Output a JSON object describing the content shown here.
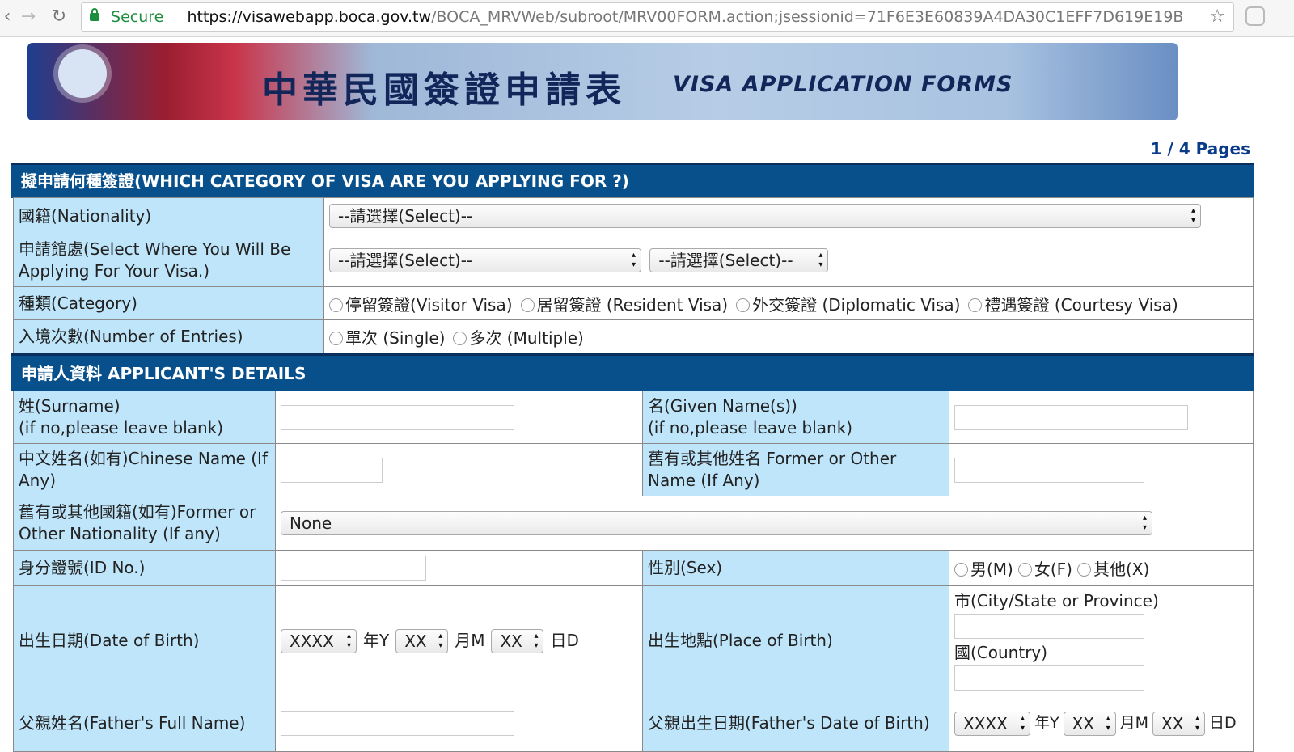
{
  "browser": {
    "secure_label": "Secure",
    "url_host": "https://visawebapp.boca.gov.tw",
    "url_path": "/BOCA_MRVWeb/subroot/MRV00FORM.action;jsessionid=71F6E3E60839A4DA30C1EFF7D619E19B"
  },
  "banner": {
    "title_zh": "中華民國簽證申請表",
    "title_en": "VISA  APPLICATION  FORMS"
  },
  "pagination": "1 / 4 Pages",
  "visa_section": {
    "heading": "擬申請何種簽證(WHICH CATEGORY OF VISA ARE YOU APPLYING FOR ?)",
    "nationality_label": "國籍(Nationality)",
    "nationality_value": "--請選擇(Select)--",
    "location_label": "申請館處(Select Where You Will Be Applying For Your Visa.)",
    "location_value_1": "--請選擇(Select)--",
    "location_value_2": "--請選擇(Select)--",
    "category_label": "種類(Category)",
    "category_options": [
      "停留簽證(Visitor Visa)",
      "居留簽證 (Resident Visa)",
      "外交簽證 (Diplomatic Visa)",
      "禮遇簽證 (Courtesy Visa)"
    ],
    "entries_label": "入境次數(Number of Entries)",
    "entries_options": [
      "單次 (Single)",
      "多次 (Multiple)"
    ]
  },
  "applicant_section": {
    "heading": "申請人資料 APPLICANT'S DETAILS",
    "surname_label": "姓(Surname)",
    "surname_note": "(if no,please leave blank)",
    "given_label": "名(Given Name(s))",
    "given_note": "(if no,please leave blank)",
    "chinese_name_label": "中文姓名(如有)Chinese Name (If Any)",
    "former_name_label": "舊有或其他姓名 Former or Other Name (If Any)",
    "former_nationality_label": "舊有或其他國籍(如有)Former or Other Nationality (If any)",
    "former_nationality_value": "None",
    "id_label": "身分證號(ID No.)",
    "sex_label": "性別(Sex)",
    "sex_options": [
      "男(M)",
      "女(F)",
      "其他(X)"
    ],
    "dob_label": "出生日期(Date of Birth)",
    "dob_year": "XXXX",
    "dob_month": "XX",
    "dob_day": "XX",
    "unit_year": "年Y",
    "unit_month": "月M",
    "unit_day": "日D",
    "pob_label": "出生地點(Place of Birth)",
    "pob_city_label": "市(City/State or Province)",
    "pob_country_label": "國(Country)",
    "father_name_label": "父親姓名(Father's Full Name)",
    "father_dob_label": "父親出生日期(Father's Date of Birth)",
    "father_dob_year": "XXXX",
    "father_dob_month": "XX",
    "father_dob_day": "XX",
    "father_unit_day": "日D"
  }
}
